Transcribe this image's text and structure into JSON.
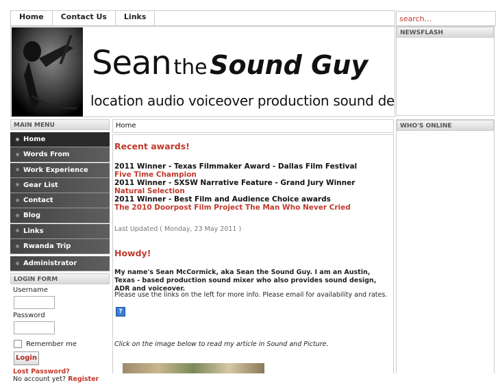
{
  "topnav": {
    "items": [
      "Home",
      "Contact Us",
      "Links"
    ]
  },
  "search": {
    "placeholder": "search..."
  },
  "header": {
    "title_sean": "Sean",
    "title_the": "the",
    "title_soundguy": "Sound Guy",
    "tagline": "location audio   voiceover production   sound design"
  },
  "right": {
    "newsflash": "NEWSFLASH",
    "whos_online": "WHO'S ONLINE"
  },
  "mainmenu": {
    "heading": "MAIN MENU",
    "items": [
      "Home",
      "Words From Colleagues",
      "Work Experience",
      "Gear List",
      "Contact",
      "Blog",
      "Links",
      "Rwanda Trip",
      "Administrator"
    ]
  },
  "loginform": {
    "heading": "LOGIN FORM",
    "username_label": "Username",
    "password_label": "Password",
    "remember_label": "Remember me",
    "login_button": "Login",
    "lost_password": "Lost Password?",
    "no_account": "No account yet?",
    "register": "Register"
  },
  "breadcrumb": "Home",
  "content": {
    "recent_awards_title": "Recent awards!",
    "award1": "2011 Winner - Texas Filmmaker Award - Dallas Film Festival",
    "award1_film": "Five Time Champion",
    "award2": "2011 Winner - SXSW Narrative Feature - Grand Jury Winner",
    "award2_film": "Natural Selection",
    "award3": "2011 Winner - Best Film and Audience Choice awards",
    "award3_film": "The 2010 Doorpost Film Project The Man Who Never Cried",
    "last_updated": "Last Updated ( Monday, 23 May 2011 )",
    "howdy_title": "Howdy!",
    "intro": "My name's Sean McCormick, aka Sean the Sound Guy. I am an Austin, Texas - based production sound mixer who also provides sound design, ADR and voiceover.",
    "links_note": "Please use the links on the left for more info. Please email for availability and rates.",
    "help_icon": "?",
    "click_note": "Click on the image below to read my article in Sound and Picture."
  },
  "colors": {
    "accent_red": "#c0392b",
    "menu_dark": "#444444",
    "border": "#cccccc"
  }
}
